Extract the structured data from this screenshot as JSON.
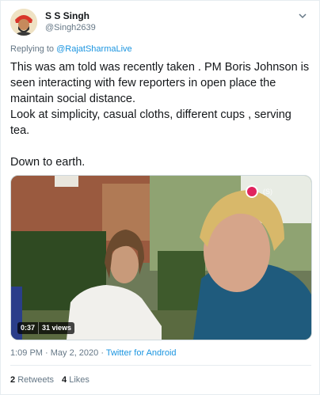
{
  "user": {
    "display_name": "S S Singh",
    "handle": "@Singh2639"
  },
  "reply": {
    "prefix": "Replying to",
    "target": "@RajatSharmaLive"
  },
  "tweet": {
    "text": "This was am told was recently taken . PM Boris Johnson is seen interacting with few reporters in open place the maintain social distance.\nLook at simplicity, casual cloths, different cups , serving tea.\n\nDown to earth."
  },
  "media": {
    "duration": "0:37",
    "views": "31 views",
    "overlay_label": "(S)"
  },
  "meta": {
    "time": "1:09 PM · May 2, 2020 · ",
    "source": "Twitter for Android"
  },
  "stats": {
    "retweets_count": "2",
    "retweets_label": "Retweets",
    "likes_count": "4",
    "likes_label": "Likes"
  },
  "icons": {
    "menu": "chevron-down-icon",
    "record": "record-icon"
  },
  "colors": {
    "link": "#1b95e0",
    "muted": "#657786",
    "text": "#14171a",
    "record": "#e0245e"
  }
}
